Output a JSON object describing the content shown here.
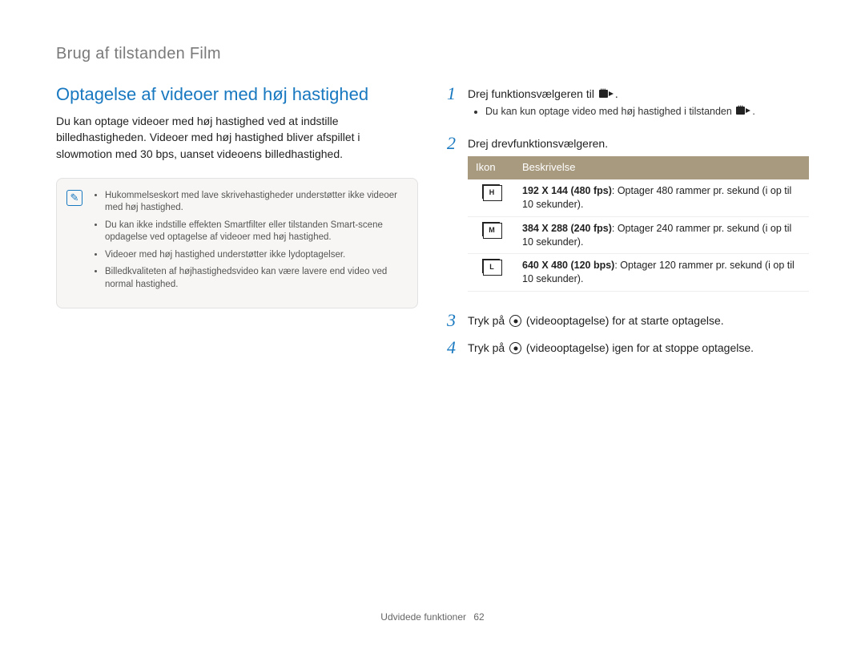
{
  "page_header": "Brug af tilstanden Film",
  "section_title": "Optagelse af videoer med høj hastighed",
  "intro_text": "Du kan optage videoer med høj hastighed ved at indstille billedhastigheden. Videoer med høj hastighed bliver afspillet i slowmotion med 30 bps, uanset videoens billedhastighed.",
  "notes": {
    "items": [
      "Hukommelseskort med lave skrivehastigheder understøtter ikke videoer med høj hastighed.",
      "Du kan ikke indstille effekten Smartfilter eller tilstanden Smart-scene opdagelse ved optagelse af videoer med høj hastighed.",
      "Videoer med høj hastighed understøtter ikke lydoptagelser.",
      "Billedkvaliteten af højhastighedsvideo kan være lavere end video ved normal hastighed."
    ]
  },
  "steps": {
    "s1": {
      "num": "1",
      "text_a": "Drej funktionsvælgeren til ",
      "text_b": ".",
      "sub": "Du kan kun optage video med høj hastighed i tilstanden ",
      "sub_b": "."
    },
    "s2": {
      "num": "2",
      "text": "Drej drevfunktionsvælgeren."
    },
    "s3": {
      "num": "3",
      "text_a": "Tryk på ",
      "text_b": " (videooptagelse) for at starte optagelse."
    },
    "s4": {
      "num": "4",
      "text_a": "Tryk på ",
      "text_b": " (videooptagelse) igen for at stoppe optagelse."
    }
  },
  "table": {
    "head_icon": "Ikon",
    "head_desc": "Beskrivelse",
    "rows": [
      {
        "letter": "H",
        "bold": "192 X 144 (480 fps)",
        "rest": ": Optager 480 rammer pr. sekund (i op til 10 sekunder)."
      },
      {
        "letter": "M",
        "bold": "384 X 288 (240 fps)",
        "rest": ": Optager 240 rammer pr. sekund (i op til 10 sekunder)."
      },
      {
        "letter": "L",
        "bold": "640 X 480 (120 bps)",
        "rest": ": Optager 120 rammer pr. sekund (i op til 10 sekunder)."
      }
    ]
  },
  "footer": {
    "section": "Udvidede funktioner",
    "page": "62"
  }
}
